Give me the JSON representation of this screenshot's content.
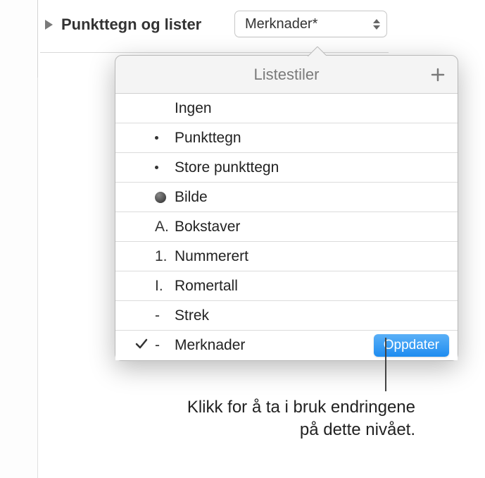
{
  "header": {
    "label": "Punkttegn og lister"
  },
  "dropdown": {
    "selected": "Merknader*"
  },
  "popover": {
    "title": "Listestiler",
    "items": [
      {
        "prefix": "",
        "label": "Ingen",
        "checked": false,
        "bullet": "none"
      },
      {
        "prefix": "",
        "label": "Punkttegn",
        "checked": false,
        "bullet": "small-dot"
      },
      {
        "prefix": "",
        "label": "Store punkttegn",
        "checked": false,
        "bullet": "small-dot"
      },
      {
        "prefix": "",
        "label": "Bilde",
        "checked": false,
        "bullet": "big-circle"
      },
      {
        "prefix": "A.",
        "label": "Bokstaver",
        "checked": false,
        "bullet": "text"
      },
      {
        "prefix": "1.",
        "label": "Nummerert",
        "checked": false,
        "bullet": "text"
      },
      {
        "prefix": "I.",
        "label": "Romertall",
        "checked": false,
        "bullet": "text"
      },
      {
        "prefix": "-",
        "label": "Strek",
        "checked": false,
        "bullet": "text"
      },
      {
        "prefix": "-",
        "label": "Merknader",
        "checked": true,
        "bullet": "text",
        "update": true
      }
    ],
    "update_label": "Oppdater"
  },
  "callout": {
    "line1": "Klikk for å ta i bruk endringene",
    "line2": "på dette nivået."
  }
}
